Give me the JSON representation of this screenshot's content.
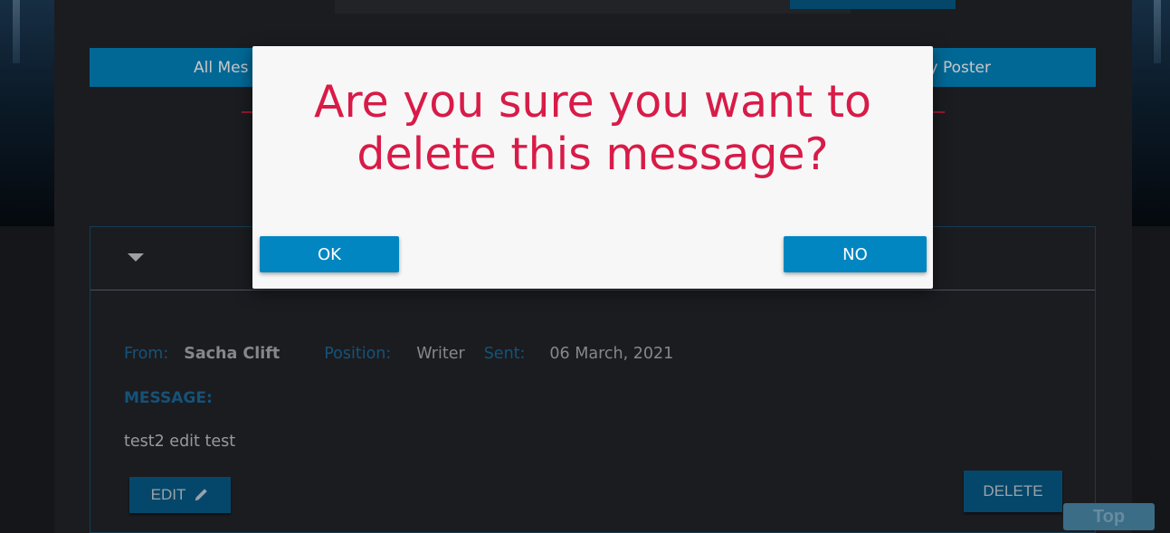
{
  "tabs": {
    "left_label": "All Mes",
    "right_label": "y Poster"
  },
  "message": {
    "from_label": "From:",
    "from_value": "Sacha Clift",
    "position_label": "Position:",
    "position_value": "Writer",
    "sent_label": "Sent:",
    "sent_value": "06 March, 2021",
    "message_label": "MESSAGE:",
    "body": "test2 edit test",
    "edit_label": "EDIT",
    "delete_label": "DELETE"
  },
  "scroll_top_label": "Top",
  "dialog": {
    "title": "Are you sure you want to delete this message?",
    "ok_label": "OK",
    "no_label": "NO"
  },
  "colors": {
    "accent": "#0286c1",
    "dark_button": "#075b88",
    "dialog_title": "#d81b47",
    "divider": "#c0213f"
  },
  "icons": {
    "edit": "pencil-icon",
    "collapse": "caret-down-icon"
  }
}
